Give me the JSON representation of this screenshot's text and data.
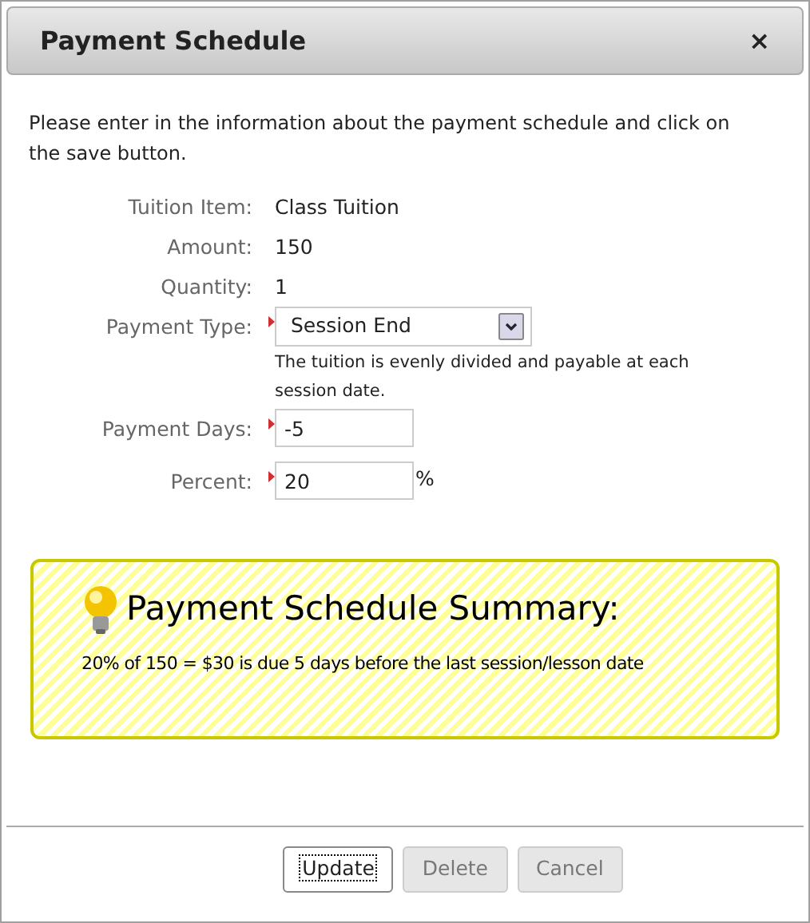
{
  "window": {
    "title": "Payment Schedule",
    "close": "×"
  },
  "intro": "Please enter in the information about the payment schedule and click on the save button.",
  "fields": [
    {
      "kind": "text",
      "label": "Tuition Item:",
      "value": "Class Tuition"
    },
    {
      "kind": "text",
      "label": "Amount:",
      "value": "150"
    },
    {
      "kind": "text",
      "label": "Quantity:",
      "value": "1"
    },
    {
      "kind": "select",
      "label": "Payment Type:",
      "required": true,
      "value": "Session End",
      "hint": "The tuition is evenly divided and payable at each session date."
    },
    {
      "kind": "input",
      "label": "Payment Days:",
      "required": true,
      "value": "-5"
    },
    {
      "kind": "input",
      "label": "Percent:",
      "required": true,
      "value": "20",
      "suffix": "%"
    }
  ],
  "summary": {
    "title": "Payment Schedule Summary:",
    "text": "20% of 150 = $30 is due 5 days before the last session/lesson date"
  },
  "buttons": [
    {
      "label": "Update",
      "focused": true
    },
    {
      "label": "Delete",
      "focused": false
    },
    {
      "label": "Cancel",
      "focused": false
    }
  ]
}
